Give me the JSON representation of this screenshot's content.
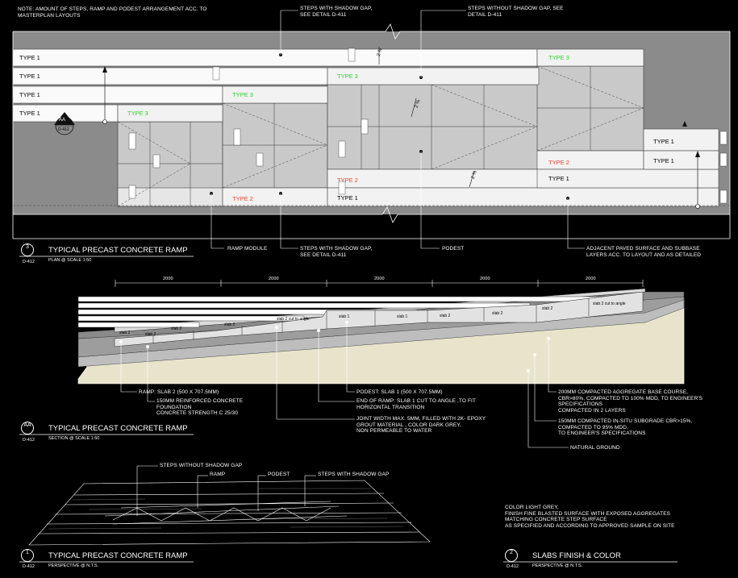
{
  "notes": {
    "top_left": "NOTE: AMOUNT OF STEPS, RAMP AND PODEST ARRANGEMENT ACC. TO\nMASTERPLAN LAYOUTS",
    "steps_shadow_top": "STEPS WITH SHADOW GAP,\nSEE DETAIL D-411",
    "steps_no_shadow_top": "STEPS WITHOUT SHADOW GAP, SEE\nDETAIL D-411",
    "ramp_module": "RAMP MODULE",
    "steps_shadow_bottom": "STEPS WITH SHADOW GAP,\nSEE DETAIL D-411",
    "podest": "PODEST",
    "adjacent": "ADJACENT PAVED SURFACE AND SUBBASE\nLAYERS ACC. TO LAYOUT AND AS DETAILED"
  },
  "plan": {
    "labels_left": [
      "TYPE 1",
      "TYPE 1",
      "TYPE 1",
      "TYPE 1"
    ],
    "type3_a": "TYPE 3",
    "type3_b": "TYPE 3",
    "type3_c": "TYPE 3",
    "type3_d": "TYPE 3",
    "type2_a": "TYPE 2",
    "type2_b": "TYPE 2",
    "type2_c": "TYPE 2",
    "type1_mid": "TYPE 1",
    "type1_mid2": "TYPE 1",
    "labels_right": [
      "TYPE 1",
      "TYPE 1"
    ],
    "slope_a": "2 %",
    "slope_b": "2 %",
    "slope_c": "2 %",
    "section_marker_letter": "AA",
    "section_marker_ref": "D-412"
  },
  "titles": {
    "plan_num": "3",
    "plan_ref": "D-412",
    "plan_title": "TYPICAL PRECAST CONCRETE RAMP",
    "plan_sub": "PLAN @ SCALE 1:50",
    "section_num": "AA",
    "section_ref": "D-412",
    "section_title": "TYPICAL PRECAST CONCRETE RAMP",
    "section_sub": "SECTION @ SCALE 1:50",
    "persp_num": "1",
    "persp_ref": "D-412",
    "persp_title": "TYPICAL PRECAST CONCRETE RAMP",
    "persp_sub": "PERSPECTIVE @ N.T.S.",
    "finish_num": "2",
    "finish_ref": "D-412",
    "finish_title": "SLABS FINISH & COLOR",
    "finish_sub": "PERSPECTIVE @ N.T.S."
  },
  "section": {
    "dims": [
      "2000",
      "2000",
      "2000",
      "2000",
      "2000"
    ],
    "slabs": [
      "slab 2",
      "slab 2",
      "slab 2",
      "slab 2",
      "slab 2 cut to angle",
      "slab 1",
      "slab 1",
      "slab 2",
      "slab 2",
      "slab 2",
      "slab 2 cut to angle"
    ],
    "callouts": {
      "ramp_slab": "RAMP: SLAB 2 (500 x 707.5mm)",
      "foundation": "150MM REINFORCED CONCRETE\nFOUNDATION\nCONCRETE STRENGTH C 25/30",
      "podest_slab": "PODEST: SLAB 1 (500 x 707.5mm)",
      "end_ramp": "END OF RAMP: SLAB 1 CUT TO ANGLE ,TO FIT\nHORIZONTAL TRANSITION",
      "joint": "JOINT WIDTH MAX. 5MM, FILLED WITH 2K- EPOXY\nGROUT MATERIAL , COLOR DARK GREY,\nNON PERMEABLE TO WATER",
      "base_course": "200MM COMPACTED AGGREGATE BASE COURSE,\nCBR>80%, COMPACTED TO 100% MDD, TO ENGINEER'S\nSPECIFICATIONS\nCOMPACTED IN 2 LAYERS",
      "subgrade": "150MM COMPACTED IN-SITU SUBGRADE CBR>15%,\nCOMPACTED TO 95% MDD,\nTO ENGINEER'S SPECIFICATIONS",
      "natural": "NATURAL GROUND"
    }
  },
  "perspective": {
    "steps_without": "STEPS WITHOUT SHADOW GAP",
    "ramp": "RAMP",
    "podest": "PODEST",
    "steps_with": "STEPS WITH SHADOW GAP"
  },
  "finish": {
    "text": "COLOR LIGHT GREY,\nFINISH FINE BLASTED SURFACE WITH EXPOSED AGGREGATES\nMATCHING CONCRETE STEP SURFACE\nAS SPECIFIED AND ACCORDING TO APPROVED SAMPLE ON SITE"
  }
}
